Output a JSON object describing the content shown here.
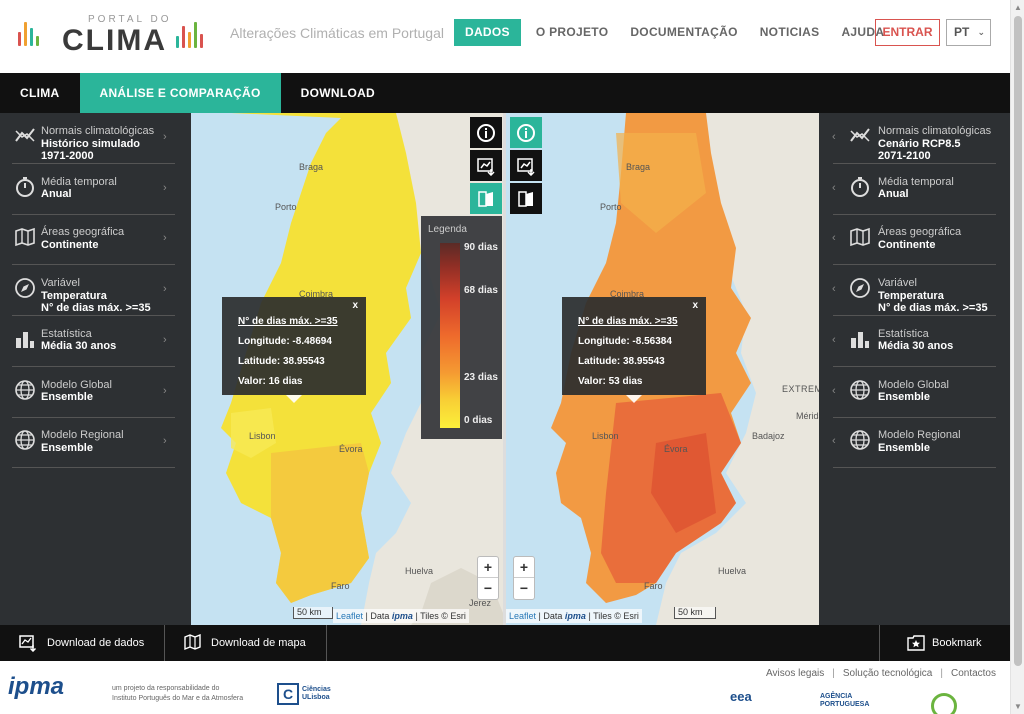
{
  "header": {
    "logo_top": "PORTAL DO",
    "logo_main": "CLIMA",
    "subtitle": "Alterações Climáticas em Portugal",
    "nav": [
      {
        "label": "DADOS"
      },
      {
        "label": "O PROJETO"
      },
      {
        "label": "DOCUMENTAÇÃO"
      },
      {
        "label": "NOTICIAS"
      },
      {
        "label": "AJUDA"
      }
    ],
    "login_label": "ENTRAR",
    "language": "PT"
  },
  "tabs": [
    {
      "label": "CLIMA"
    },
    {
      "label": "ANÁLISE E COMPARAÇÃO"
    },
    {
      "label": "DOWNLOAD"
    }
  ],
  "left_panel": [
    {
      "icon": "trend-icon",
      "t1": "Normais climatológicas",
      "t2": "Histórico simulado",
      "t3": "1971-2000"
    },
    {
      "icon": "stopwatch-icon",
      "t1": "Média temporal",
      "t2": "Anual",
      "t3": ""
    },
    {
      "icon": "map-icon",
      "t1": "Áreas geográfica",
      "t2": "Continente",
      "t3": ""
    },
    {
      "icon": "compass-icon",
      "t1": "Variável",
      "t2": "Temperatura",
      "t3": "N° de dias máx. >=35"
    },
    {
      "icon": "bar-chart-icon",
      "t1": "Estatística",
      "t2": "Média 30 anos",
      "t3": ""
    },
    {
      "icon": "globe-icon",
      "t1": "Modelo Global",
      "t2": "Ensemble",
      "t3": ""
    },
    {
      "icon": "globe-icon",
      "t1": "Modelo Regional",
      "t2": "Ensemble",
      "t3": ""
    }
  ],
  "right_panel": [
    {
      "icon": "trend-icon",
      "t1": "Normais climatológicas",
      "t2": "Cenário RCP8.5",
      "t3": "2071-2100"
    },
    {
      "icon": "stopwatch-icon",
      "t1": "Média temporal",
      "t2": "Anual",
      "t3": ""
    },
    {
      "icon": "map-icon",
      "t1": "Áreas geográfica",
      "t2": "Continente",
      "t3": ""
    },
    {
      "icon": "compass-icon",
      "t1": "Variável",
      "t2": "Temperatura",
      "t3": "N° de dias máx. >=35"
    },
    {
      "icon": "bar-chart-icon",
      "t1": "Estatística",
      "t2": "Média 30 anos",
      "t3": ""
    },
    {
      "icon": "globe-icon",
      "t1": "Modelo Global",
      "t2": "Ensemble",
      "t3": ""
    },
    {
      "icon": "globe-icon",
      "t1": "Modelo Regional",
      "t2": "Ensemble",
      "t3": ""
    }
  ],
  "legend": {
    "title": "Legenda",
    "labels": [
      "90 dias",
      "68 dias",
      "23 dias",
      "0 dias"
    ]
  },
  "map_left": {
    "places": [
      "Braga",
      "Porto",
      "Coimbra",
      "Lisbon",
      "Évora",
      "Faro",
      "Huelva",
      "Jerez"
    ],
    "popup": {
      "close": "x",
      "title": "N° de dias máx. >=35",
      "lon": "Longitude: -8.48694",
      "lat": "Latitude: 38.95543",
      "value": "Valor: 16 dias"
    },
    "scale": "50 km",
    "attrib_leaflet": "Leaflet",
    "attrib_data": "| Data",
    "attrib_tiles": "| Tiles © Esri"
  },
  "map_right": {
    "places": [
      "Braga",
      "Porto",
      "Coimbra",
      "Lisbon",
      "Évora",
      "Faro",
      "Huelva",
      "Badajoz",
      "Mérida",
      "EXTREM"
    ],
    "popup": {
      "close": "x",
      "title": "N° de dias máx. >=35",
      "lon": "Longitude: -8.56384",
      "lat": "Latitude: 38.95543",
      "value": "Valor: 53 dias"
    },
    "scale": "50 km",
    "attrib_leaflet": "Leaflet",
    "attrib_data": "| Data",
    "attrib_tiles": "| Tiles © Esri"
  },
  "zoom": {
    "in": "+",
    "out": "−"
  },
  "ipma_small": "ipma",
  "bottom": {
    "download_data": "Download de dados",
    "download_map": "Download de mapa",
    "bookmark": "Bookmark"
  },
  "footer": {
    "links": [
      "Avisos legais",
      "Solução tecnológica",
      "Contactos"
    ],
    "separator": "|",
    "ipma": "ipma",
    "caption": [
      "um projeto da responsabilidade do",
      "Instituto Português do Mar e da Atmosfera"
    ],
    "ciencias_letter": "C",
    "ciencias": [
      "Ciências",
      "ULisboa"
    ],
    "eea": "eea",
    "agencia": [
      "AGÊNCIA",
      "PORTUGUESA"
    ]
  },
  "colors": {
    "accent": "#2bb59a",
    "dark": "#111111",
    "sidebar": "#2d3033",
    "login": "#d9534f",
    "map_left_fill": "#f4e13a",
    "map_right_fill": "#f29a43"
  }
}
